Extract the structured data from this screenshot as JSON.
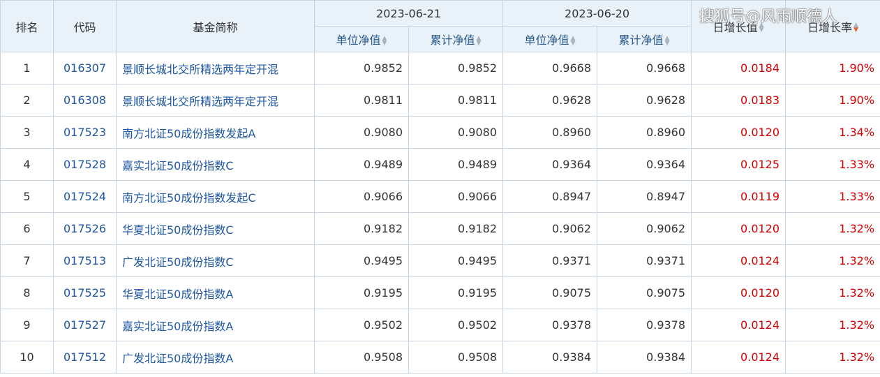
{
  "headers": {
    "rank": "排名",
    "code": "代码",
    "name": "基金简称",
    "date1": "2023-06-21",
    "date2": "2023-06-20",
    "unit_nav": "单位净值",
    "acc_nav": "累计净值",
    "daily_growth": "日增长值",
    "daily_rate": "日增长率"
  },
  "watermark": "搜狐号@风雨顺德人",
  "rows": [
    {
      "rank": "1",
      "code": "016307",
      "name": "景顺长城北交所精选两年定开混",
      "u1": "0.9852",
      "a1": "0.9852",
      "u2": "0.9668",
      "a2": "0.9668",
      "gv": "0.0184",
      "gr": "1.90%"
    },
    {
      "rank": "2",
      "code": "016308",
      "name": "景顺长城北交所精选两年定开混",
      "u1": "0.9811",
      "a1": "0.9811",
      "u2": "0.9628",
      "a2": "0.9628",
      "gv": "0.0183",
      "gr": "1.90%"
    },
    {
      "rank": "3",
      "code": "017523",
      "name": "南方北证50成份指数发起A",
      "u1": "0.9080",
      "a1": "0.9080",
      "u2": "0.8960",
      "a2": "0.8960",
      "gv": "0.0120",
      "gr": "1.34%"
    },
    {
      "rank": "4",
      "code": "017528",
      "name": "嘉实北证50成份指数C",
      "u1": "0.9489",
      "a1": "0.9489",
      "u2": "0.9364",
      "a2": "0.9364",
      "gv": "0.0125",
      "gr": "1.33%"
    },
    {
      "rank": "5",
      "code": "017524",
      "name": "南方北证50成份指数发起C",
      "u1": "0.9066",
      "a1": "0.9066",
      "u2": "0.8947",
      "a2": "0.8947",
      "gv": "0.0119",
      "gr": "1.33%"
    },
    {
      "rank": "6",
      "code": "017526",
      "name": "华夏北证50成份指数C",
      "u1": "0.9182",
      "a1": "0.9182",
      "u2": "0.9062",
      "a2": "0.9062",
      "gv": "0.0120",
      "gr": "1.32%"
    },
    {
      "rank": "7",
      "code": "017513",
      "name": "广发北证50成份指数C",
      "u1": "0.9495",
      "a1": "0.9495",
      "u2": "0.9371",
      "a2": "0.9371",
      "gv": "0.0124",
      "gr": "1.32%"
    },
    {
      "rank": "8",
      "code": "017525",
      "name": "华夏北证50成份指数A",
      "u1": "0.9195",
      "a1": "0.9195",
      "u2": "0.9075",
      "a2": "0.9075",
      "gv": "0.0120",
      "gr": "1.32%"
    },
    {
      "rank": "9",
      "code": "017527",
      "name": "嘉实北证50成份指数A",
      "u1": "0.9502",
      "a1": "0.9502",
      "u2": "0.9378",
      "a2": "0.9378",
      "gv": "0.0124",
      "gr": "1.32%"
    },
    {
      "rank": "10",
      "code": "017512",
      "name": "广发北证50成份指数A",
      "u1": "0.9508",
      "a1": "0.9508",
      "u2": "0.9384",
      "a2": "0.9384",
      "gv": "0.0124",
      "gr": "1.32%"
    }
  ]
}
